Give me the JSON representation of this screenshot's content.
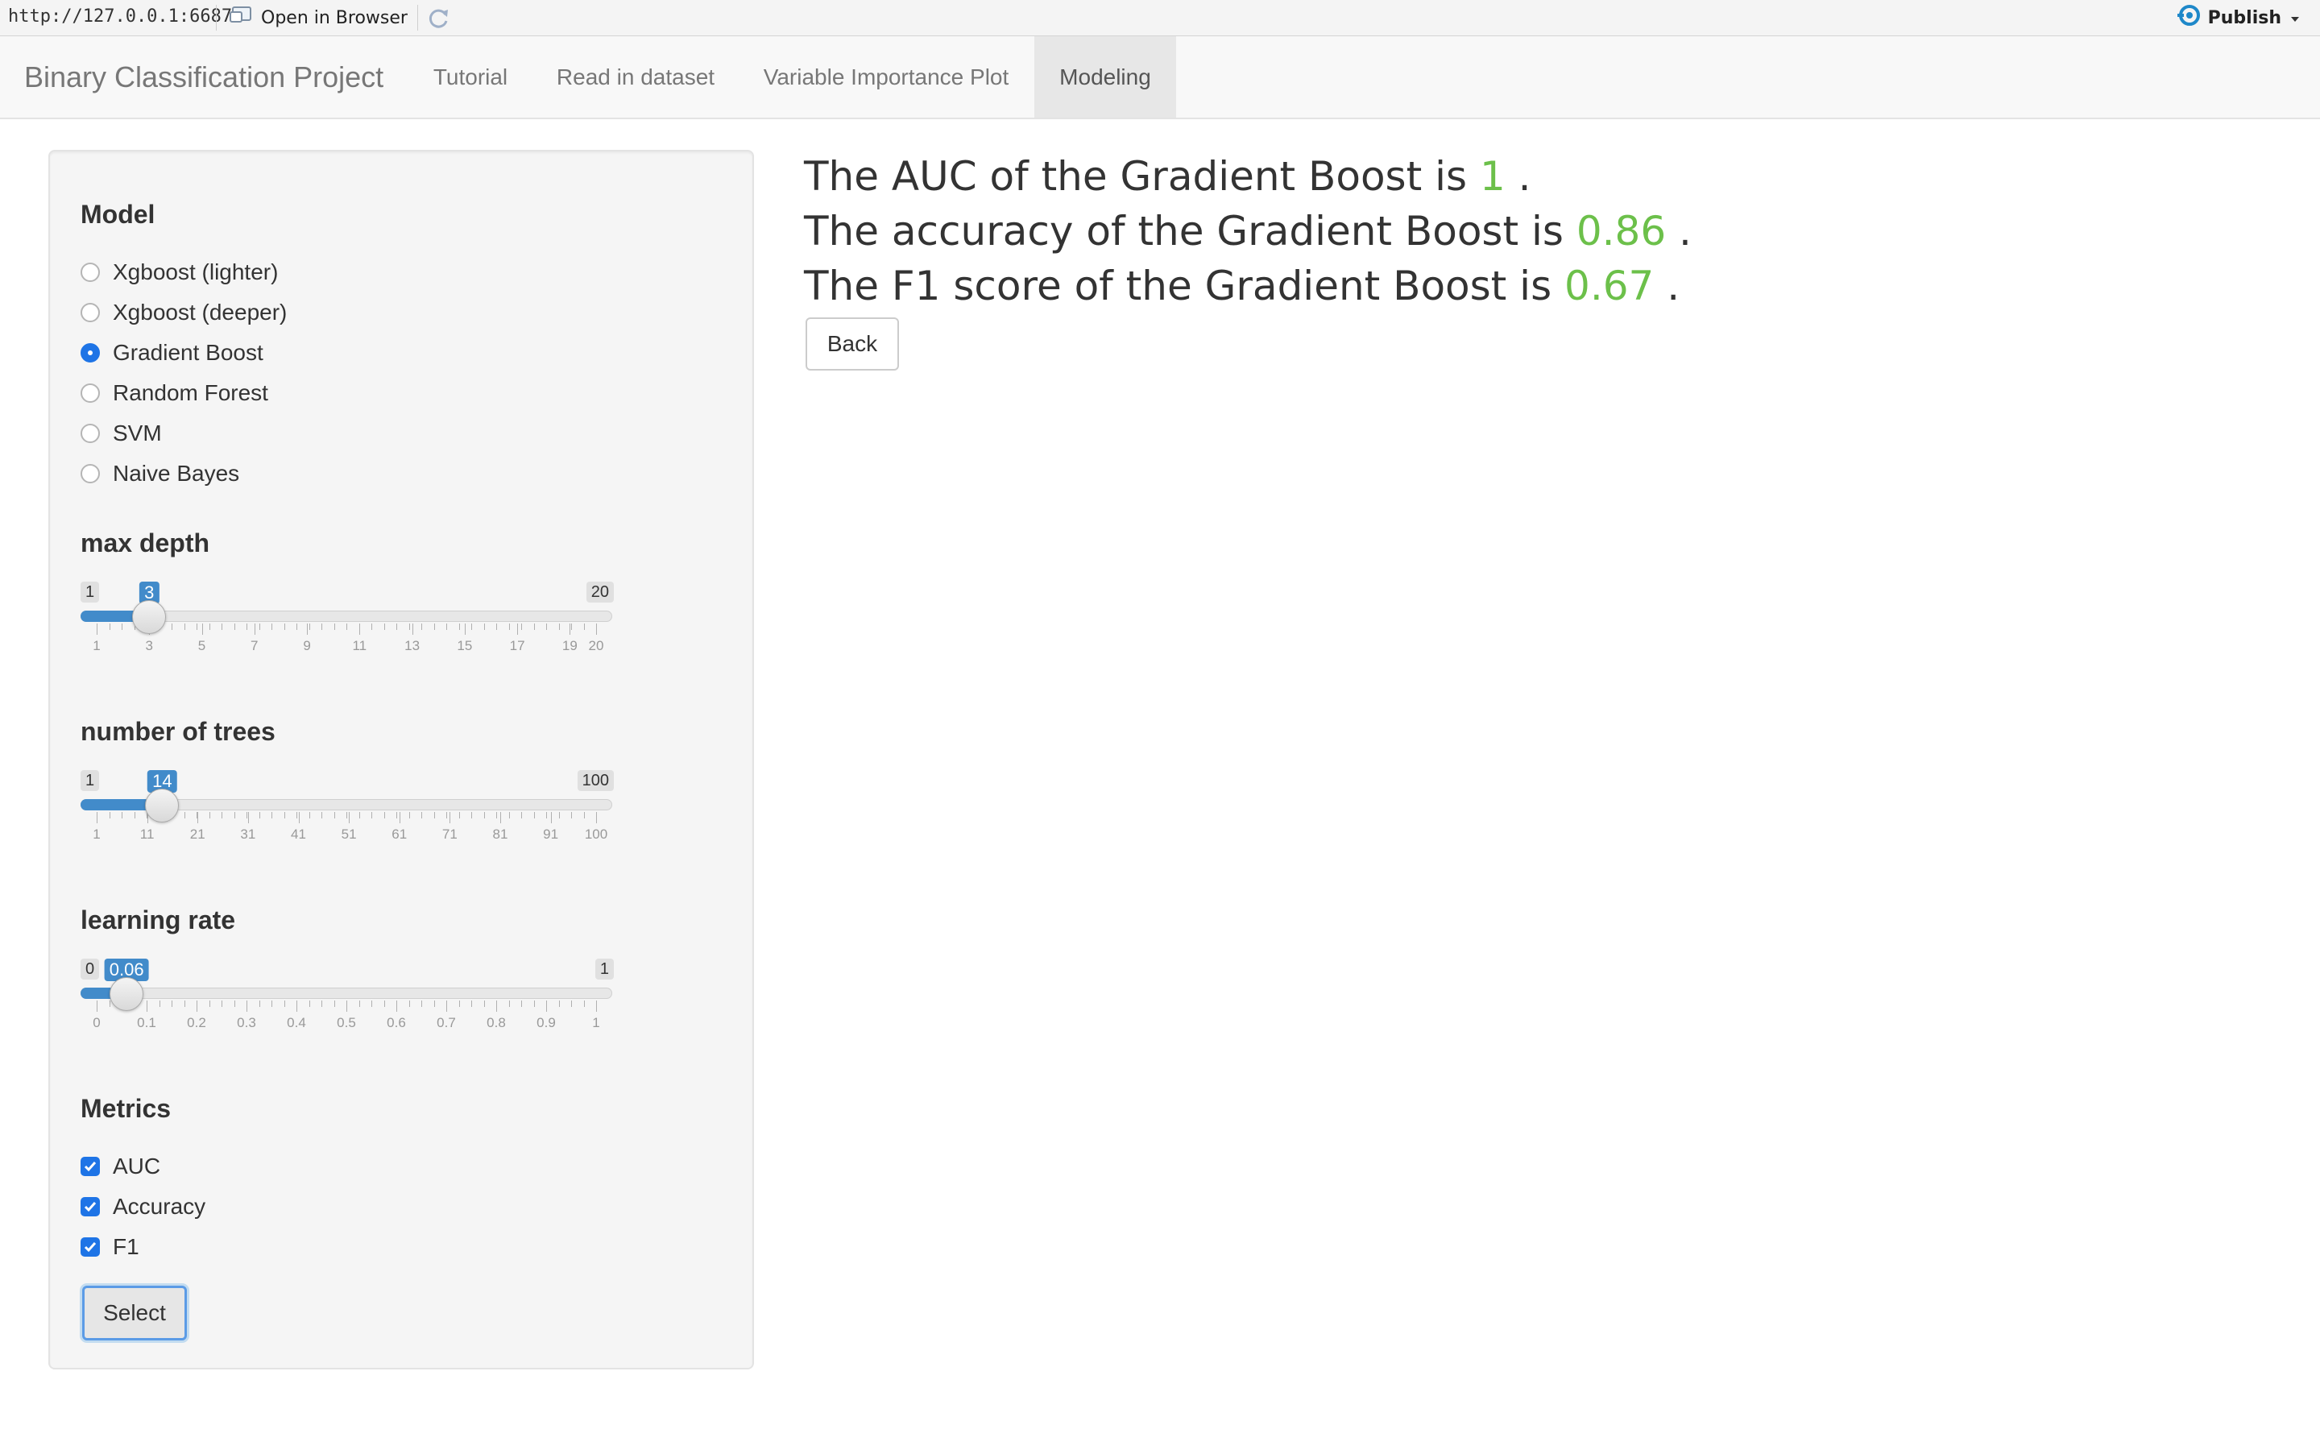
{
  "viewer": {
    "url": "http://127.0.0.1:6687",
    "open_in_browser": "Open in Browser",
    "publish": "Publish",
    "icons": [
      "open-in-browser-icon",
      "refresh-icon",
      "publish-icon",
      "chevron-down-icon"
    ]
  },
  "navbar": {
    "brand": "Binary Classification Project",
    "tabs": [
      {
        "label": "Tutorial",
        "active": false
      },
      {
        "label": "Read in dataset",
        "active": false
      },
      {
        "label": "Variable Importance Plot",
        "active": false
      },
      {
        "label": "Modeling",
        "active": true
      }
    ]
  },
  "sidebar": {
    "model_label": "Model",
    "models": [
      {
        "label": "Xgboost (lighter)",
        "selected": false
      },
      {
        "label": "Xgboost (deeper)",
        "selected": false
      },
      {
        "label": "Gradient Boost",
        "selected": true
      },
      {
        "label": "Random Forest",
        "selected": false
      },
      {
        "label": "SVM",
        "selected": false
      },
      {
        "label": "Naive Bayes",
        "selected": false
      }
    ],
    "sliders": [
      {
        "label": "max depth",
        "min": 1,
        "max": 20,
        "value": 3,
        "min_label": "1",
        "max_label": "20",
        "value_label": "3",
        "ticks": [
          "1",
          "3",
          "5",
          "7",
          "9",
          "11",
          "13",
          "15",
          "17",
          "19",
          "20"
        ]
      },
      {
        "label": "number of trees",
        "min": 1,
        "max": 100,
        "value": 14,
        "min_label": "1",
        "max_label": "100",
        "value_label": "14",
        "ticks": [
          "1",
          "11",
          "21",
          "31",
          "41",
          "51",
          "61",
          "71",
          "81",
          "91",
          "100"
        ]
      },
      {
        "label": "learning rate",
        "min": 0,
        "max": 1,
        "value": 0.06,
        "min_label": "0",
        "max_label": "1",
        "value_label": "0.06",
        "ticks": [
          "0",
          "0.1",
          "0.2",
          "0.3",
          "0.4",
          "0.5",
          "0.6",
          "0.7",
          "0.8",
          "0.9",
          "1"
        ]
      }
    ],
    "metrics_label": "Metrics",
    "metrics": [
      {
        "label": "AUC",
        "checked": true
      },
      {
        "label": "Accuracy",
        "checked": true
      },
      {
        "label": "F1",
        "checked": true
      }
    ],
    "select_button": "Select"
  },
  "results": {
    "lines": [
      {
        "prefix": "The AUC of the Gradient Boost is",
        "value": "1",
        "suffix": "."
      },
      {
        "prefix": "The accuracy of the Gradient Boost is",
        "value": "0.86",
        "suffix": "."
      },
      {
        "prefix": "The F1 score of the Gradient Boost is",
        "value": "0.67",
        "suffix": "."
      }
    ],
    "value_color": "#6cc04a",
    "back_button": "Back"
  },
  "colors": {
    "accent": "#1e74e6",
    "slider_fill": "#428bca"
  }
}
